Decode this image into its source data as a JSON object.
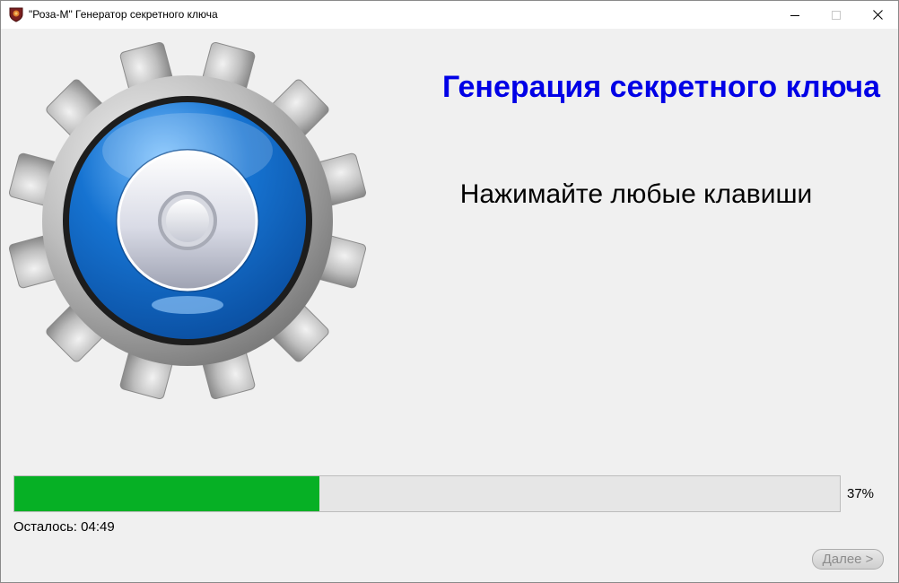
{
  "window": {
    "title": "\"Роза-М\" Генератор секретного ключа"
  },
  "main": {
    "heading": "Генерация секретного ключа",
    "instruction": "Нажимайте любые клавиши"
  },
  "progress": {
    "value": 0.37,
    "percent_label": "37%",
    "remaining_label": "Осталось:",
    "remaining_time": "04:49"
  },
  "buttons": {
    "next_label": "Далее >"
  },
  "icons": {
    "app": "rose-shield-icon",
    "gear": "gear-icon"
  },
  "colors": {
    "heading": "#0000e6",
    "progress_fill": "#06b025"
  }
}
